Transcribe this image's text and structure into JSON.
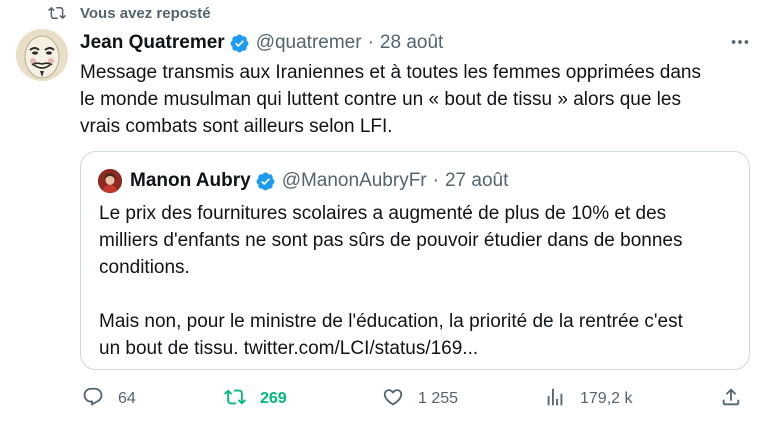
{
  "repost": {
    "label": "Vous avez reposté"
  },
  "tweet": {
    "author_name": "Jean Quatremer",
    "handle": "@quatremer",
    "separator": "·",
    "date": "28 août",
    "text_lines": [
      "Message transmis aux Iraniennes et à toutes les femmes opprimées dans",
      "le monde musulman qui luttent contre un « bout de tissu » alors que les",
      "vrais combats sont ailleurs selon LFI."
    ]
  },
  "quote": {
    "author_name": "Manon Aubry",
    "handle": "@ManonAubryFr",
    "separator": "·",
    "date": "27 août",
    "paragraph1_lines": [
      "Le prix des fournitures scolaires a augmenté de plus de 10% et des",
      "milliers d'enfants ne sont pas sûrs de pouvoir étudier dans de bonnes",
      "conditions."
    ],
    "paragraph2_lines": [
      "Mais non, pour le ministre de l'éducation, la priorité de la rentrée c'est",
      "un bout de tissu. twitter.com/LCI/status/169..."
    ]
  },
  "actions": {
    "replies": "64",
    "retweets": "269",
    "likes": "1 255",
    "views": "179,2 k"
  },
  "colors": {
    "secondary_text": "#536471",
    "verified_blue": "#1d9bf0",
    "retweet_green": "#00ba7c",
    "border": "#cfd9de"
  },
  "icons": [
    "repost-icon",
    "verified-badge-icon",
    "more-icon",
    "reply-icon",
    "retweet-icon",
    "like-icon",
    "views-icon",
    "share-icon"
  ]
}
